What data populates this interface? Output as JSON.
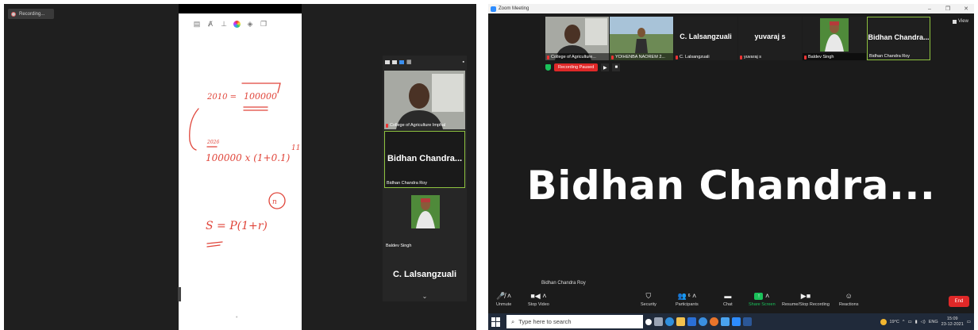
{
  "left": {
    "recording_label": "Recording...",
    "panel_tiles": [
      {
        "name": "College of Agriculture Imphal"
      },
      {
        "name": "Bidhan Chandra Roy",
        "big": "Bidhan  Chandra..."
      },
      {
        "name": "Baldev Singh"
      },
      {
        "big": "C. Lalsangzuali"
      }
    ],
    "whiteboard": {
      "line1_left": "2010 =",
      "line1_right": "100000",
      "line2_label": "2026",
      "line2": "100000 x (1+0.1)",
      "line2_exp": "11",
      "line3": "S = P(1+r)",
      "line3_exp": "n"
    }
  },
  "zoom": {
    "window_title": "Zoom Meeting",
    "view_label": "View",
    "recording_status": "Recording Paused",
    "strip": [
      {
        "name": "College of Agriculture..."
      },
      {
        "name": "YOIHENBA NAOREM 2..."
      },
      {
        "name": "C. Lalsangzuali",
        "big": "C. Lalsangzuali"
      },
      {
        "name": "yuvaraj s",
        "big": "yuvaraj s"
      },
      {
        "name": "Baldev Singh"
      },
      {
        "name": "Bidhan Chandra Roy",
        "big": "Bidhan  Chandra..."
      }
    ],
    "active_speaker": "Bidhan  Chandra...",
    "active_speaker_full": "Bidhan Chandra Roy",
    "toolbar": {
      "unmute": "Unmute",
      "stop_video": "Stop Video",
      "security": "Security",
      "participants": "Participants",
      "participants_count": "6",
      "chat": "Chat",
      "share_screen": "Share Screen",
      "record": "Resume/Stop Recording",
      "reactions": "Reactions",
      "end": "End"
    },
    "taskbar": {
      "search_placeholder": "Type here to search",
      "weather": "19°C",
      "lang": "ENG",
      "time": "15:09",
      "date": "23-12-2021"
    }
  },
  "colors": {
    "accent_green": "#8fc340",
    "record_red": "#e02828",
    "share_green": "#1ac15a",
    "ink_red": "#e0453a"
  }
}
